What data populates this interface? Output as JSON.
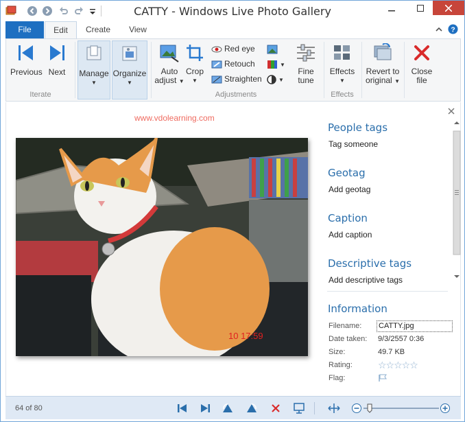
{
  "window": {
    "title": "CATTY - Windows Live Photo Gallery"
  },
  "ribbon_tabs": [
    {
      "label": "File"
    },
    {
      "label": "Edit"
    },
    {
      "label": "Create"
    },
    {
      "label": "View"
    }
  ],
  "ribbon": {
    "iterate": {
      "label": "Iterate",
      "previous": "Previous",
      "next": "Next"
    },
    "manage": "Manage",
    "organize": "Organize",
    "adjustments": {
      "label": "Adjustments",
      "auto_adjust_1": "Auto",
      "auto_adjust_2": "adjust",
      "crop": "Crop",
      "red_eye": "Red eye",
      "retouch": "Retouch",
      "straighten": "Straighten",
      "fine_tune_1": "Fine",
      "fine_tune_2": "tune"
    },
    "effects": {
      "label": "Effects",
      "button": "Effects"
    },
    "revert_1": "Revert to",
    "revert_2": "original",
    "close_1": "Close",
    "close_2": "file"
  },
  "content": {
    "watermark": "www.vdolearning.com",
    "photo_timestamp": "10  17:59"
  },
  "sidepane": {
    "people_tags": {
      "heading": "People tags",
      "link": "Tag someone"
    },
    "geotag": {
      "heading": "Geotag",
      "link": "Add geotag"
    },
    "caption": {
      "heading": "Caption",
      "link": "Add caption"
    },
    "descriptive_tags": {
      "heading": "Descriptive tags",
      "link": "Add descriptive tags"
    },
    "information": {
      "heading": "Information",
      "filename_label": "Filename:",
      "filename_value": "CATTY.jpg",
      "date_label": "Date taken:",
      "date_value": "9/3/2557  0:36",
      "size_label": "Size:",
      "size_value": "49.7 KB",
      "rating_label": "Rating:",
      "rating_stars": 0,
      "flag_label": "Flag:"
    }
  },
  "statusbar": {
    "counter": "64 of 80"
  },
  "colors": {
    "accent": "#1e6fc1",
    "close_red": "#c7453a",
    "heading_blue": "#2a6eab",
    "statusbar": "#dfe9f5"
  }
}
